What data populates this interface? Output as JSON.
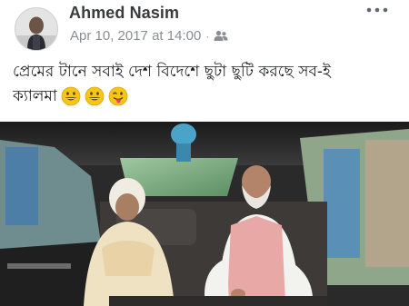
{
  "post": {
    "author_name": "Ahmed Nasim",
    "timestamp": "Apr 10, 2017 at 14:00",
    "separator": "·",
    "audience_icon": "friends-icon",
    "more_icon": "more-dots-icon",
    "caption_line1": "প্রেমের টানে সবাই দেশ বিদেশে ছুটা ছুটি করছে সব-ই",
    "caption_line2": "ক্যালমা",
    "emojis": [
      "grinning-face",
      "grinning-face",
      "tongue-face"
    ],
    "photo_description_icon": "car-interior-photo"
  },
  "colors": {
    "name": "#3a3b3d",
    "meta": "#8a8d91",
    "text": "#1c1e21",
    "emoji_yellow": "#f5c518"
  }
}
